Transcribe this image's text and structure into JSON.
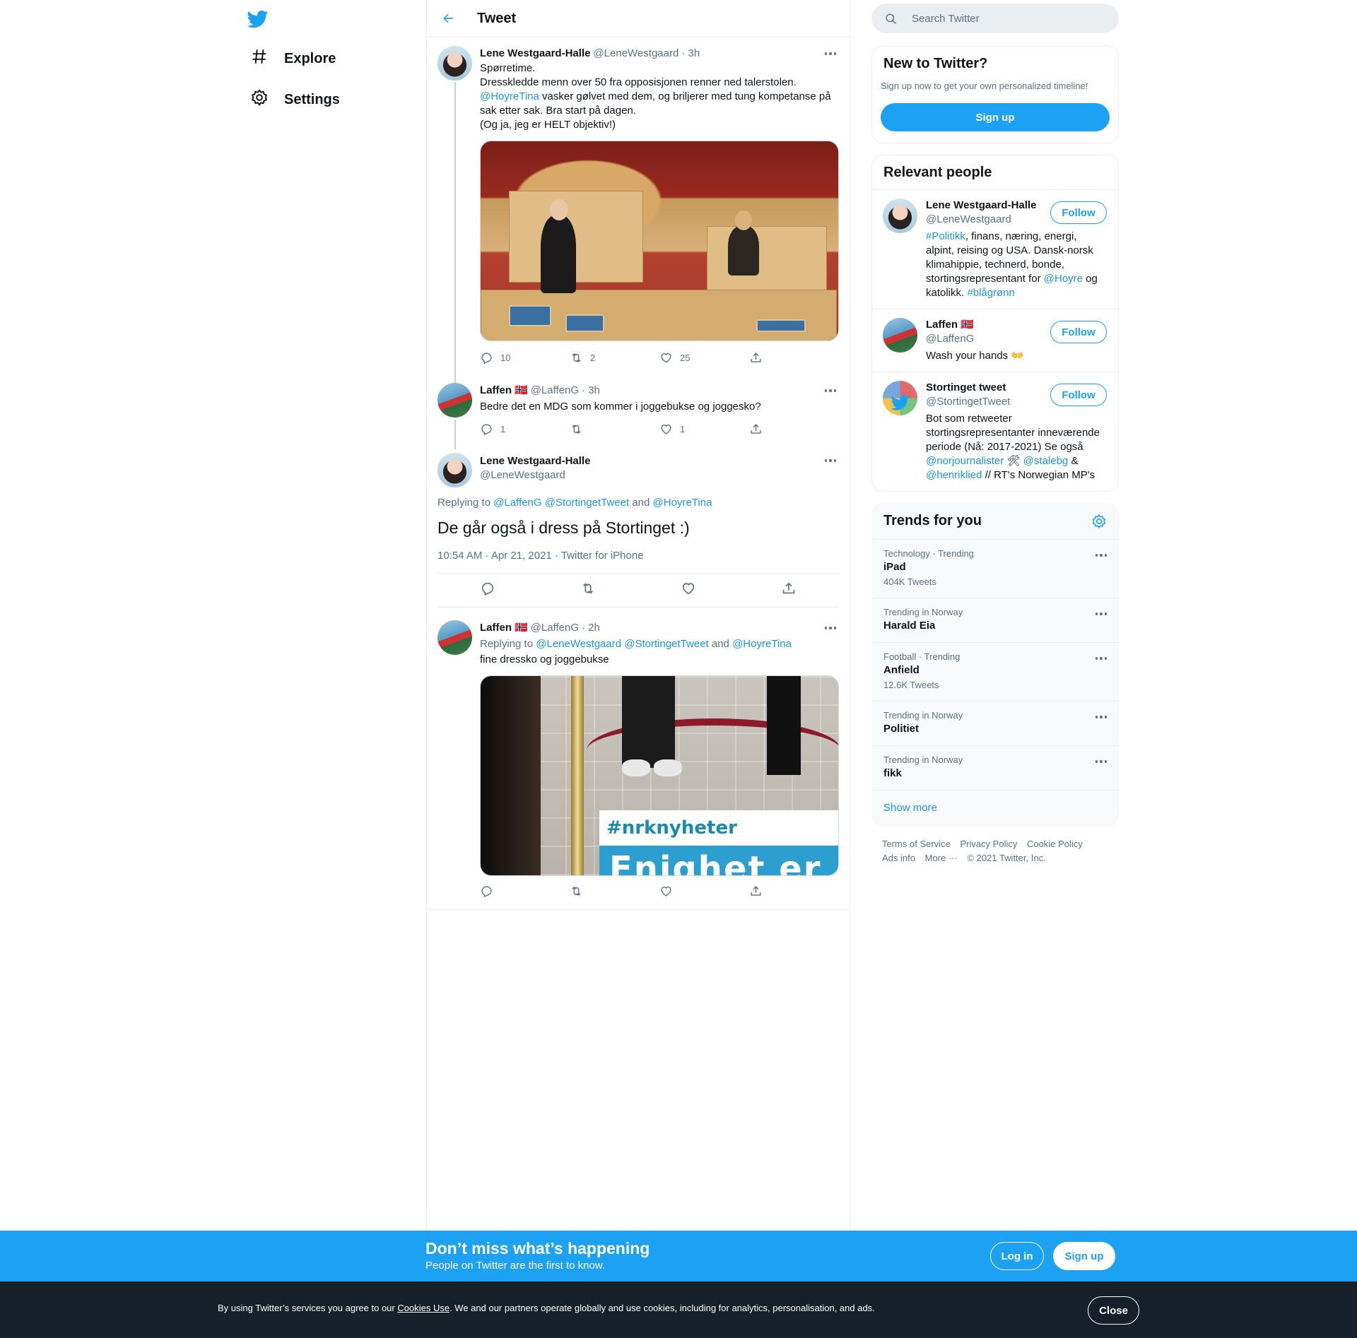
{
  "nav": {
    "explore": "Explore",
    "settings": "Settings"
  },
  "header": {
    "title": "Tweet"
  },
  "tweets": {
    "t1": {
      "name": "Lene Westgaard-Halle",
      "handle": "@LeneWestgaard",
      "time": "· 3h",
      "line1": "Spørretime.",
      "line2": "Dresskledde menn over 50 fra opposisjonen renner ned talerstolen.",
      "mention": "@HoyreTina",
      "line3": " vasker gølvet med dem, og briljerer med tung kompetanse på sak etter sak. Bra start på dagen.",
      "line4": "(Og ja, jeg er HELT objektiv!)",
      "replies": "10",
      "retweets": "2",
      "likes": "25"
    },
    "t2": {
      "name": "Laffen",
      "flag": "🇳🇴",
      "handle": "@LaffenG",
      "time": "· 3h",
      "text": "Bedre det en MDG som kommer i joggebukse og joggesko?",
      "replies": "1",
      "retweets": "",
      "likes": "1"
    },
    "focal": {
      "name": "Lene Westgaard-Halle",
      "handle": "@LeneWestgaard",
      "replying_prefix": "Replying to ",
      "replying_1": "@LaffenG",
      "replying_2": "@StortingetTweet",
      "replying_and": " and ",
      "replying_3": "@HoyreTina",
      "text": "De går også i dress på Stortinget :)",
      "meta": "10:54 AM · Apr 21, 2021 · Twitter for iPhone"
    },
    "t4": {
      "name": "Laffen",
      "flag": "🇳🇴",
      "handle": "@LaffenG",
      "time": "· 2h",
      "replying_prefix": "Replying to ",
      "replying_1": "@LeneWestgaard",
      "replying_2": "@StortingetTweet",
      "replying_and": " and ",
      "replying_3": "@HoyreTina",
      "text": "fine dressko og joggebukse",
      "image_tag": "#nrknyheter",
      "image_sign": "Enighet er"
    }
  },
  "search": {
    "placeholder": "Search Twitter"
  },
  "new_to_twitter": {
    "title": "New to Twitter?",
    "subtitle": "Sign up now to get your own personalized timeline!",
    "button": "Sign up"
  },
  "relevant_people": {
    "title": "Relevant people",
    "follow_label": "Follow",
    "people": [
      {
        "name": "Lene Westgaard-Halle",
        "handle": "@LeneWestgaard",
        "bio_tag1": "#Politikk",
        "bio_a": ", finans, næring, energi, alpint, reising og USA. Dansk-norsk klimahippie, technerd, bonde, stortingsrepresentant for ",
        "bio_tag2": "@Hoyre",
        "bio_b": " og katolikk. ",
        "bio_tag3": "#blågrønn"
      },
      {
        "name": "Laffen",
        "flag": "🇳🇴",
        "handle": "@LaffenG",
        "bio": "Wash your hands 👐"
      },
      {
        "name": "Stortinget tweet",
        "handle": "@StortingetTweet",
        "bio_a": "Bot som retweeter stortingsrepresentanter inneværende periode (Nå: 2017-2021) Se også ",
        "bio_tag1": "@norjournalister",
        "bio_emoji": " 🛠 ",
        "bio_tag2": "@stalebg",
        "bio_b": " & ",
        "bio_tag3": "@henriklied",
        "bio_c": " // RT's Norwegian MP's"
      }
    ]
  },
  "trends": {
    "title": "Trends for you",
    "items": [
      {
        "context": "Technology · Trending",
        "name": "iPad",
        "count": "404K Tweets"
      },
      {
        "context": "Trending in Norway",
        "name": "Harald Eia",
        "count": ""
      },
      {
        "context": "Football · Trending",
        "name": "Anfield",
        "count": "12.6K Tweets"
      },
      {
        "context": "Trending in Norway",
        "name": "Politiet",
        "count": ""
      },
      {
        "context": "Trending in Norway",
        "name": "fikk",
        "count": ""
      }
    ],
    "show_more": "Show more"
  },
  "footer": {
    "terms": "Terms of Service",
    "privacy": "Privacy Policy",
    "cookie": "Cookie Policy",
    "ads": "Ads info",
    "more": "More ···",
    "copyright": "© 2021 Twitter, Inc."
  },
  "signup_bar": {
    "title": "Don’t miss what’s happening",
    "subtitle": "People on Twitter are the first to know.",
    "login": "Log in",
    "signup": "Sign up"
  },
  "cookie_bar": {
    "text_a": "By using Twitter’s services you agree to our ",
    "link": "Cookies Use",
    "text_b": ". We and our partners operate globally and use cookies, including for analytics, personalisation, and ads.",
    "close": "Close"
  },
  "colors": {
    "accent": "#1da1f2",
    "link": "#1b95e0",
    "text": "#0f1419",
    "muted": "#5b7083",
    "cookie_bg": "#15202b"
  }
}
